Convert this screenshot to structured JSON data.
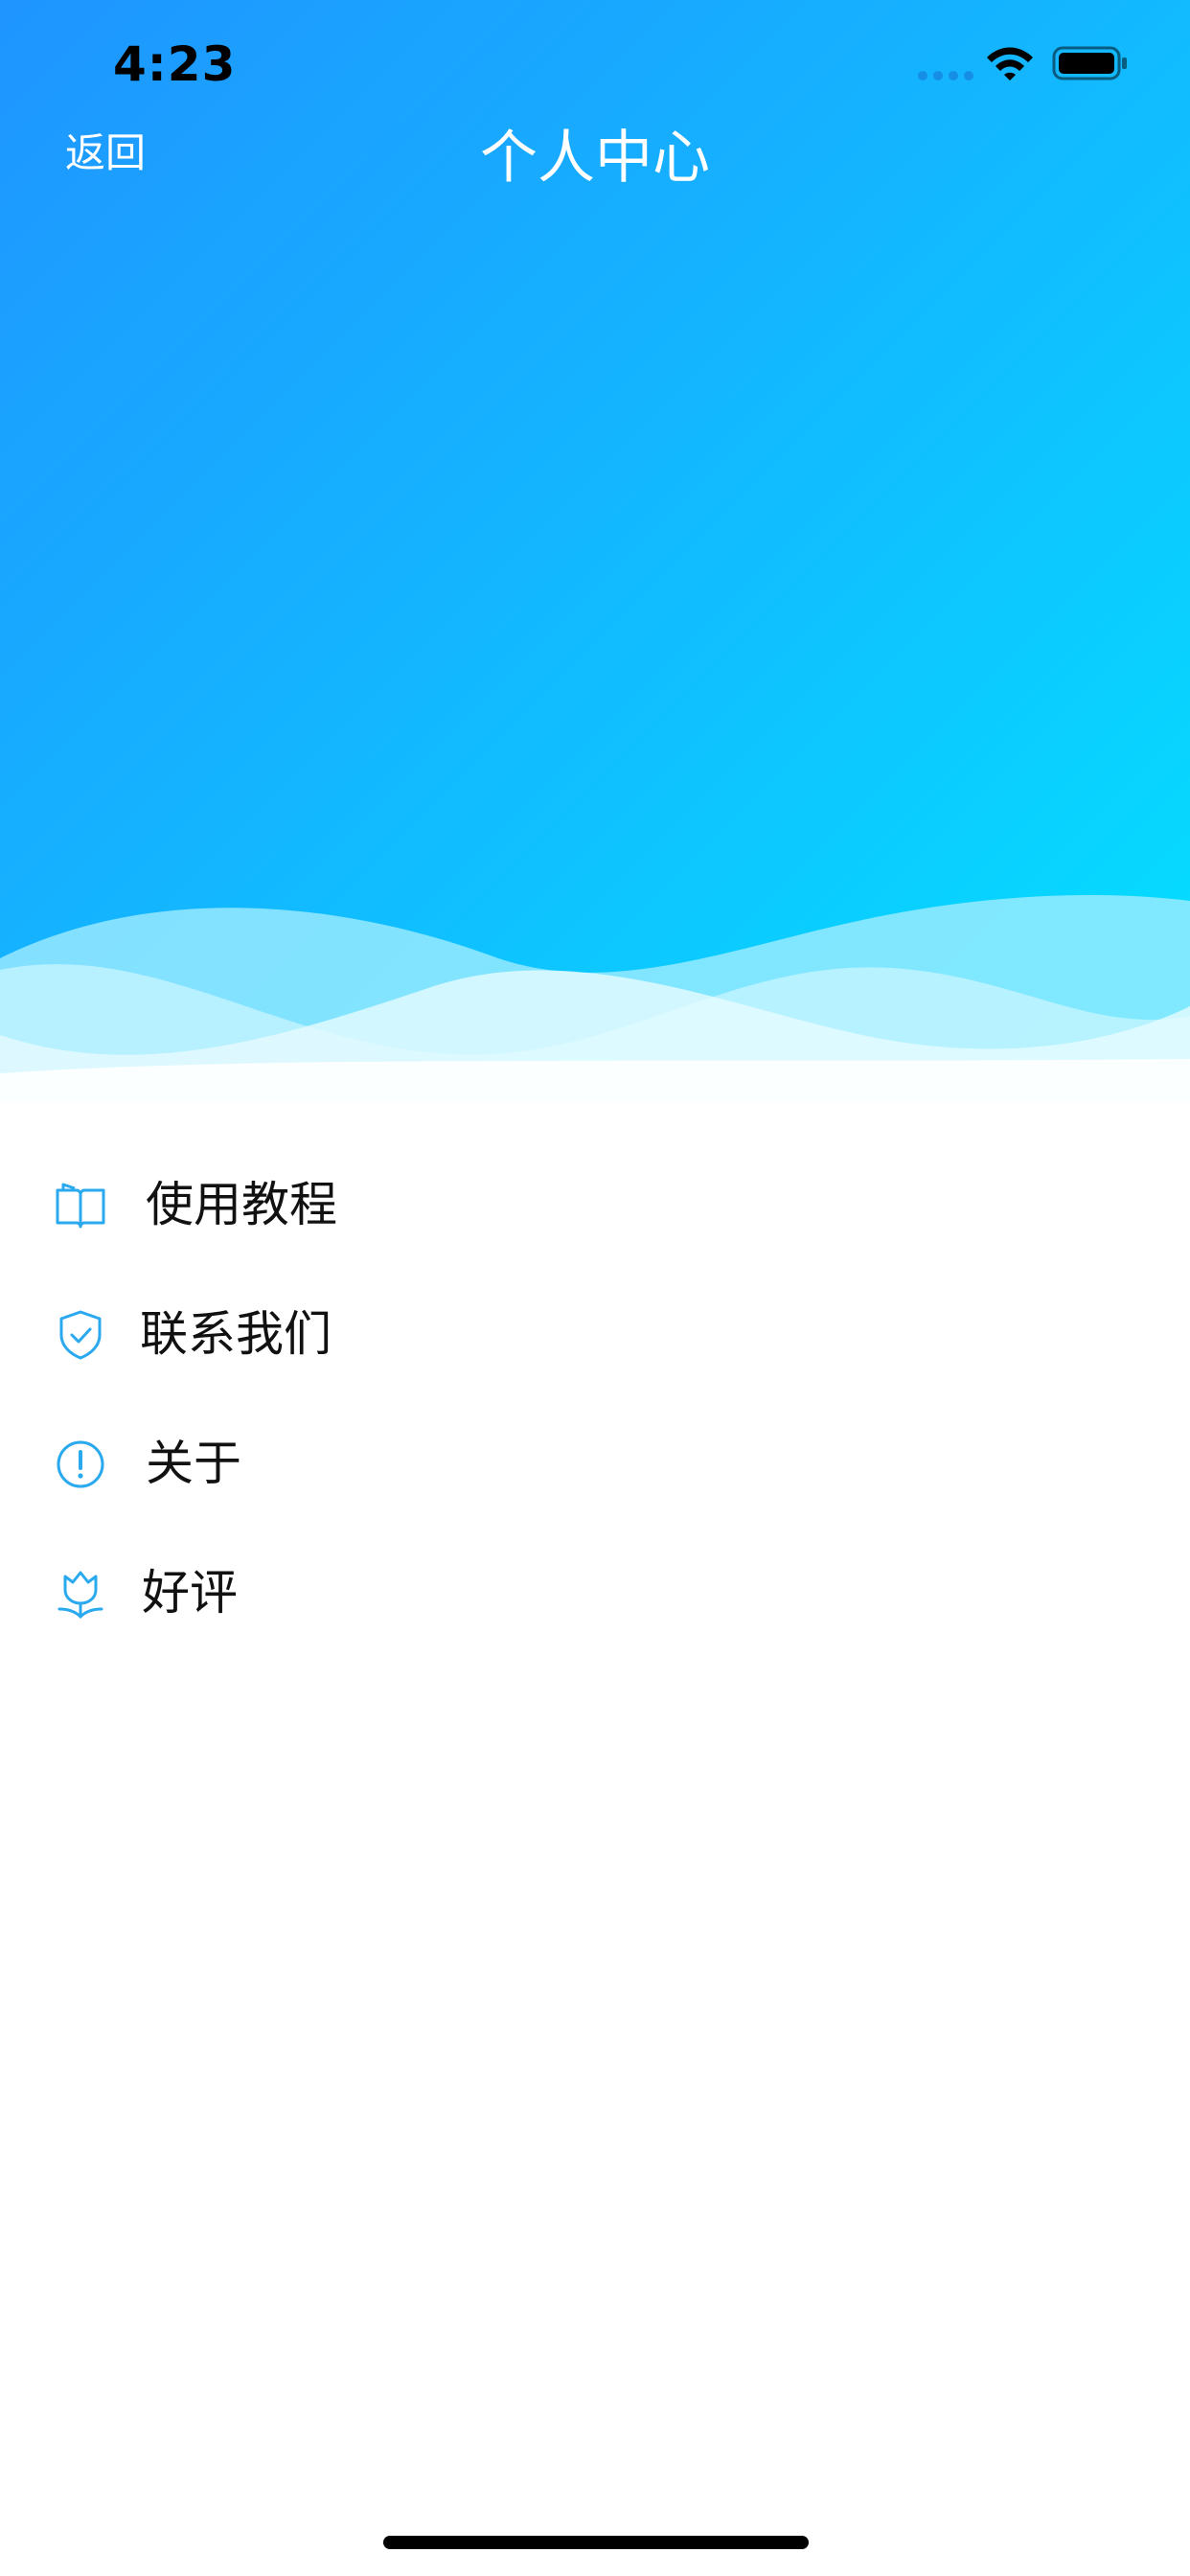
{
  "status_bar": {
    "time": "4:23"
  },
  "nav": {
    "back_label": "返回",
    "title": "个人中心"
  },
  "menu": {
    "items": [
      {
        "label": "使用教程",
        "icon": "book-icon"
      },
      {
        "label": "联系我们",
        "icon": "shield-check-icon"
      },
      {
        "label": "关于",
        "icon": "info-circle-icon"
      },
      {
        "label": "好评",
        "icon": "flower-icon"
      }
    ]
  },
  "colors": {
    "header_gradient_start": "#1f95ff",
    "header_gradient_end": "#03e1ff",
    "icon_accent": "#2aa9ee",
    "text": "#111111"
  }
}
